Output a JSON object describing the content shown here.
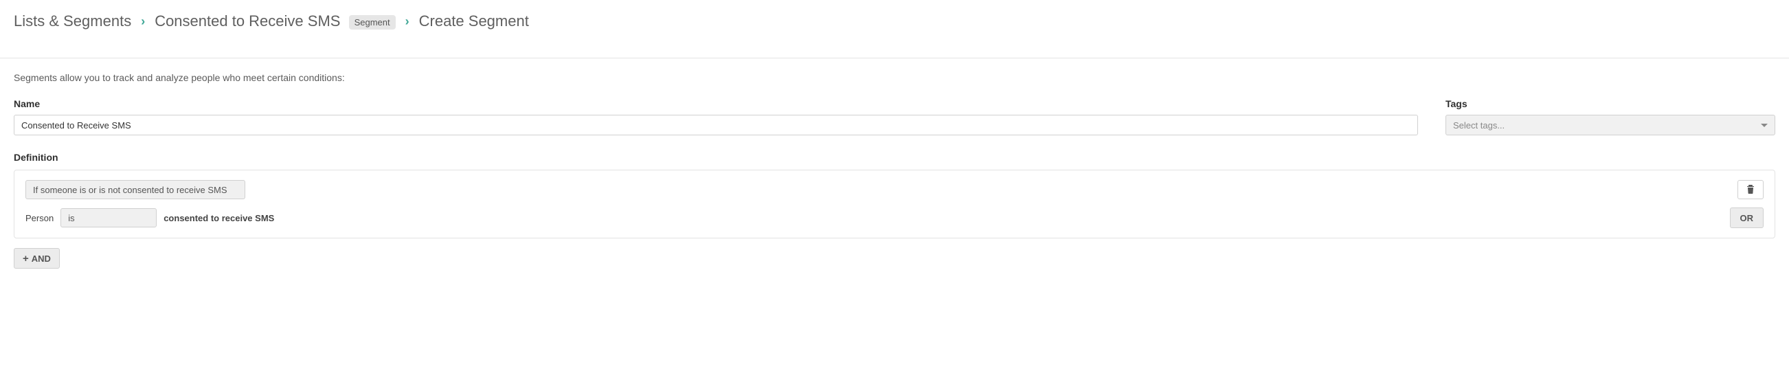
{
  "breadcrumb": {
    "root": "Lists & Segments",
    "segment_name": "Consented to Receive SMS",
    "segment_badge": "Segment",
    "current": "Create Segment"
  },
  "intro": "Segments allow you to track and analyze people who meet certain conditions:",
  "fields": {
    "name_label": "Name",
    "name_value": "Consented to Receive SMS",
    "tags_label": "Tags",
    "tags_placeholder": "Select tags..."
  },
  "definition": {
    "label": "Definition",
    "condition_type": "If someone is or is not consented to receive SMS",
    "person_label": "Person",
    "operator": "is",
    "suffix": "consented to receive SMS",
    "or_label": "OR",
    "and_label": "AND"
  }
}
